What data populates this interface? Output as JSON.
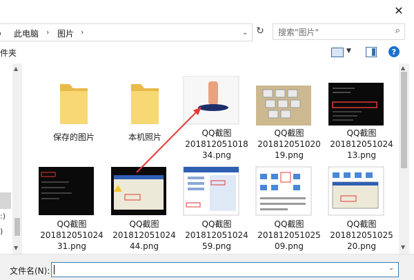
{
  "window": {
    "close_glyph": "✕"
  },
  "address": {
    "crumbs": [
      "此电脑",
      "图片"
    ],
    "edge_glyph": "⌂",
    "sep": "›",
    "dropdown_glyph": "⌄",
    "refresh_glyph": "↻"
  },
  "search": {
    "placeholder": "搜索\"图片\"",
    "icon": "search-icon"
  },
  "toolbar": {
    "new_folder_fragment": "件夹",
    "help": "?",
    "dropdown_glyph": "▼"
  },
  "nav": {
    "fragments": [
      ":)",
      ")"
    ]
  },
  "items": [
    {
      "lines": [
        "保存的图片"
      ],
      "kind": "folder"
    },
    {
      "lines": [
        "本机照片"
      ],
      "kind": "folder"
    },
    {
      "lines": [
        "QQ截图",
        "201812051018",
        "34.png"
      ],
      "kind": "image"
    },
    {
      "lines": [
        "QQ截图",
        "201812051020",
        "19.png"
      ],
      "kind": "image"
    },
    {
      "lines": [
        "QQ截图",
        "201812051024",
        "13.png"
      ],
      "kind": "image"
    },
    {
      "lines": [
        "QQ截图",
        "201812051024",
        "31.png"
      ],
      "kind": "image"
    },
    {
      "lines": [
        "QQ截图",
        "201812051024",
        "44.png"
      ],
      "kind": "image"
    },
    {
      "lines": [
        "QQ截图",
        "201812051024",
        "59.png"
      ],
      "kind": "image"
    },
    {
      "lines": [
        "QQ截图",
        "201812051025",
        "09.png"
      ],
      "kind": "image"
    },
    {
      "lines": [
        "QQ截图",
        "201812051025",
        "20.png"
      ],
      "kind": "image"
    }
  ],
  "filename": {
    "label": "文件名(N):",
    "value": "",
    "dropdown_glyph": "⌄"
  },
  "colors": {
    "folder": "#f8d775",
    "folder_dark": "#e9b949",
    "annotation": "#e53935",
    "accent": "#1f6fd1"
  }
}
